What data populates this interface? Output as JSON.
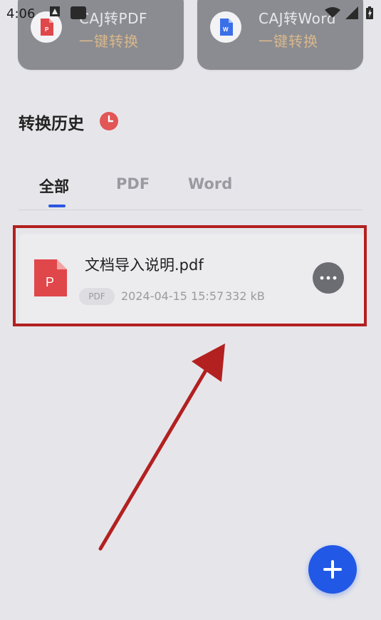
{
  "status_bar": {
    "time": "4:06"
  },
  "cards": [
    {
      "title": "CAJ转PDF",
      "subtitle": "一键转换",
      "icon": "pdf-file-icon"
    },
    {
      "title": "CAJ转Word",
      "subtitle": "一键转换",
      "icon": "word-file-icon"
    }
  ],
  "history": {
    "title": "转换历史",
    "icon": "clock-icon",
    "tabs": [
      {
        "label": "全部",
        "active": true
      },
      {
        "label": "PDF",
        "active": false
      },
      {
        "label": "Word",
        "active": false
      }
    ],
    "files": [
      {
        "name": "文档导入说明.pdf",
        "type_badge": "PDF",
        "date": "2024-04-15 15:57",
        "size": "332 kB",
        "icon_letter": "P"
      }
    ]
  },
  "colors": {
    "accent": "#2258e6",
    "pdf_red": "#e0474a",
    "highlight": "#b32020",
    "card_subtitle": "#d9b78c"
  },
  "fab": {
    "icon": "plus-icon"
  }
}
